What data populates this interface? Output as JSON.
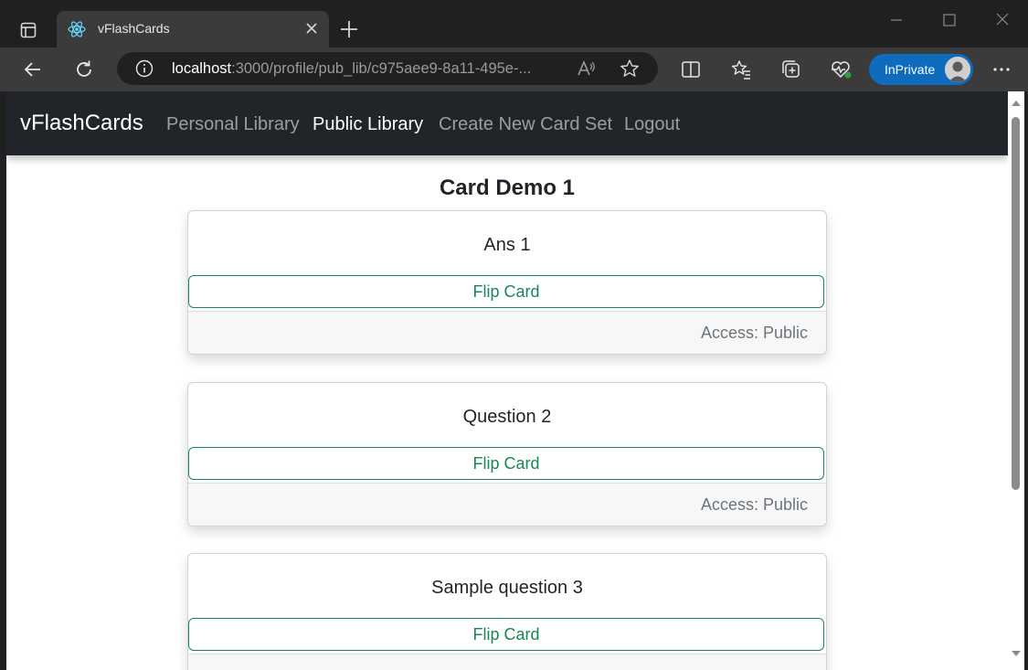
{
  "browser": {
    "tab_title": "vFlashCards",
    "url_host": "localhost",
    "url_rest": ":3000/profile/pub_lib/c975aee9-8a11-495e-...",
    "inprivate_label": "InPrivate"
  },
  "navbar": {
    "brand": "vFlashCards",
    "links": [
      "Personal Library",
      "Public Library",
      "Create New Card Set",
      "Logout"
    ],
    "active_link": "Public Library"
  },
  "card_set": {
    "title": "Card Demo 1",
    "cards": [
      {
        "text": "Ans 1",
        "button": "Flip Card",
        "access": "Access: Public"
      },
      {
        "text": "Question 2",
        "button": "Flip Card",
        "access": "Access: Public"
      },
      {
        "text": "Sample question 3",
        "button": "Flip Card",
        "access": ""
      }
    ]
  },
  "colors": {
    "navbar_bg": "#212529",
    "flip_button": "#198754",
    "inprivate_badge": "#0f6cbd"
  }
}
